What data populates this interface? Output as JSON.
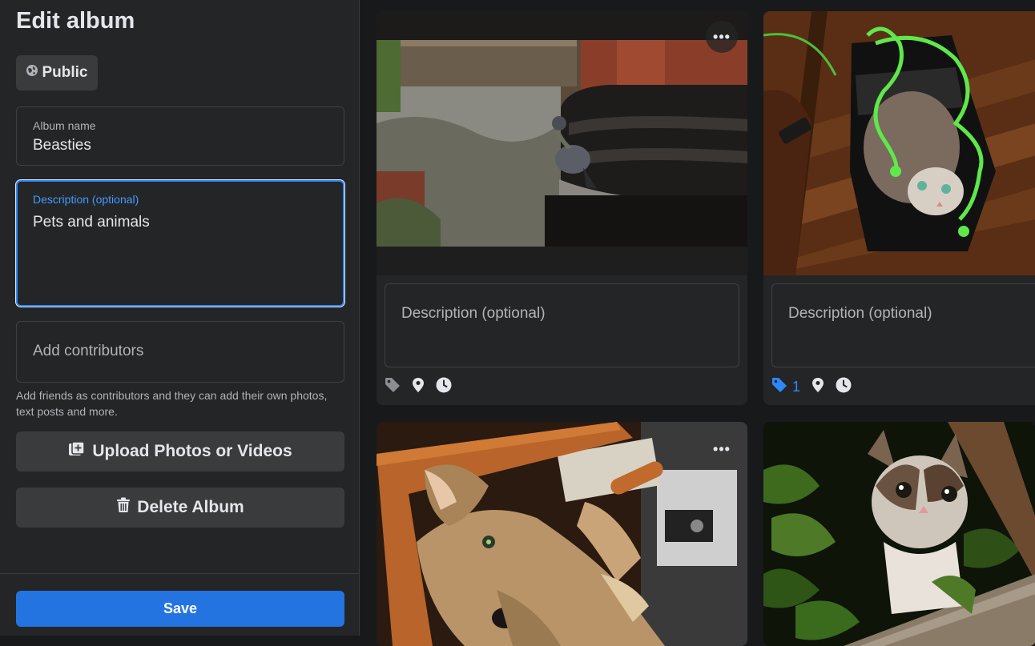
{
  "sidebar": {
    "title": "Edit album",
    "privacy_label": "Public",
    "album_name": {
      "label": "Album name",
      "value": "Beasties"
    },
    "description": {
      "label": "Description (optional)",
      "value": "Pets and animals"
    },
    "contributors": {
      "placeholder": "Add contributors"
    },
    "helper_text": "Add friends as contributors and they can add their own photos, text posts and more.",
    "upload_label": "Upload Photos or Videos",
    "delete_label": "Delete Album",
    "save_label": "Save"
  },
  "photos": [
    {
      "subject": "pigeon on stone pillar by canal",
      "description_placeholder": "Description (optional)",
      "tag_count": ""
    },
    {
      "subject": "kitten in shopping bag",
      "description_placeholder": "Description (optional)",
      "tag_count": "1"
    },
    {
      "subject": "dog lying upside down"
    },
    {
      "subject": "kitten among leaves"
    }
  ],
  "icons": {
    "privacy": "globe-icon",
    "upload": "add-photo-icon",
    "delete": "trash-icon",
    "more": "more-options-icon",
    "tag": "tag-icon",
    "location": "location-pin-icon",
    "time": "clock-icon"
  },
  "colors": {
    "accent": "#2d88ff",
    "save_button": "#2374e1",
    "surface": "#242526",
    "background": "#18191a"
  }
}
